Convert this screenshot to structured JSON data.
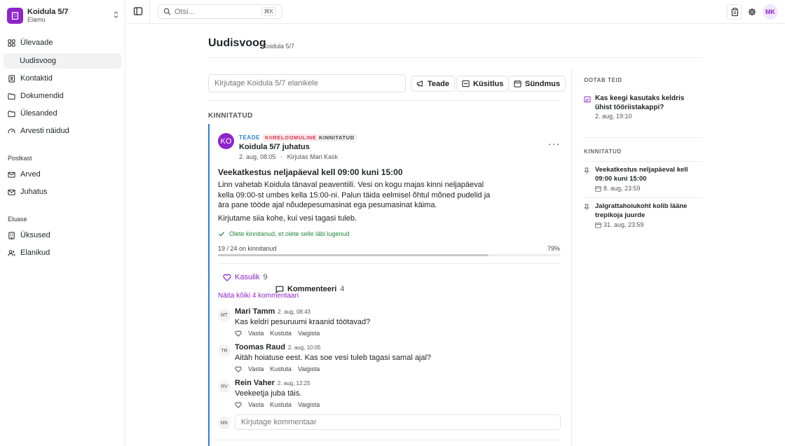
{
  "brand": {
    "name": "Koidula 5/7",
    "sub": "Elamu"
  },
  "nav": {
    "main": [
      {
        "label": "Ülevaade",
        "icon": "grid-icon"
      },
      {
        "label": "Uudisvoog",
        "icon": "none"
      },
      {
        "label": "Kontaktid",
        "icon": "contact-book-icon"
      },
      {
        "label": "Dokumendid",
        "icon": "folder-icon"
      },
      {
        "label": "Ülesanded",
        "icon": "folder-icon"
      },
      {
        "label": "Arvesti näidud",
        "icon": "gauge-icon"
      }
    ],
    "postkast_heading": "Postkast",
    "postkast": [
      {
        "label": "Arved",
        "icon": "mail-icon"
      },
      {
        "label": "Juhatus",
        "icon": "mail-icon"
      }
    ],
    "eluase_heading": "Eluase",
    "eluase": [
      {
        "label": "Üksused",
        "icon": "building-icon"
      },
      {
        "label": "Elanikud",
        "icon": "users-icon"
      }
    ]
  },
  "topbar": {
    "search_placeholder": "Otsi...",
    "search_shortcut": "⌘K",
    "avatar": "MK"
  },
  "header": {
    "title": "Uudisvoog",
    "subtitle": "Koidula 5/7"
  },
  "composer": {
    "placeholder": "Kirjutage Koidula 5/7 elanikele",
    "btn_notice": "Teade",
    "btn_poll": "Küsitlus",
    "btn_event": "Sündmus"
  },
  "pinned_label": "KINNITATUD",
  "post": {
    "avatar": "KO",
    "tag_type": "TEADE",
    "tag_urgent": "KIIRELOOMULINE",
    "tag_pinned": "KINNITATUD",
    "author": "Koidula 5/7 juhatus",
    "date": "2. aug, 08:05",
    "meta_sep": "·",
    "written_by": "Kirjutas Mari Kask",
    "title": "Veekatkestus neljapäeval kell 09:00 kuni 15:00",
    "body": "Linn vahetab Koidula tänaval peaventiili. Vesi on kogu majas kinni neljapäeval kella 09:00-st umbes kella 15:00-ni. Palun täida eelmisel õhtul mõned pudelid ja ära pane tööde ajal nõudepesumasinat ega pesumasinat käima.",
    "body2": "Kirjutame siia kohe, kui vesi tagasi tuleb.",
    "ack_text": "Olete kinnitanud, et olete selle läbi lugenud",
    "progress_text": "19 / 24 on kinnitanud",
    "progress_pct": "79%",
    "progress_value": 0.79,
    "like_label": "Kasulik",
    "like_count": "9",
    "comment_label": "Kommenteeri",
    "comment_count": "4",
    "show_all": "Näita kõiki 4 kommentaari",
    "comments": [
      {
        "initials": "MT",
        "name": "Mari Tamm",
        "time": "2. aug, 08:43",
        "text": "Kas keldri pesuruumi kraanid töötavad?",
        "reply": "Vasta",
        "delete": "Kustuta",
        "silence": "Vaigista"
      },
      {
        "initials": "TR",
        "name": "Toomas Raud",
        "time": "2. aug, 10:05",
        "text": "Aitäh hoiatuse eest. Kas soe vesi tuleb tagasi samal ajal?",
        "reply": "Vasta",
        "delete": "Kustuta",
        "silence": "Vaigista"
      },
      {
        "initials": "RV",
        "name": "Rein Vaher",
        "time": "2. aug, 12:25",
        "text": "Veekeetja juba täis.",
        "reply": "Vasta",
        "delete": "Kustuta",
        "silence": "Vaigista"
      }
    ],
    "input_avatar": "MK",
    "input_placeholder": "Kirjutage kommentaar"
  },
  "right": {
    "waiting_heading": "OOTAB TEID",
    "waiting": [
      {
        "title": "Kas keegi kasutaks keldris ühist tööriistakappi?",
        "meta": "2. aug, 19:10"
      }
    ],
    "pinned_heading": "KINNITATUD",
    "pinned": [
      {
        "title": "Veekatkestus neljapäeval kell 09:00 kuni 15:00",
        "meta": "8. aug, 23:59"
      },
      {
        "title": "Jalgrattahoiukoht kolib lääne trepikoja juurde",
        "meta": "31. aug, 23:59"
      }
    ]
  },
  "colors": {
    "accent": "#8e24c9",
    "pinned_border": "#2b7fd1",
    "urgent": "#d6334b",
    "success": "#1f8a3b"
  }
}
